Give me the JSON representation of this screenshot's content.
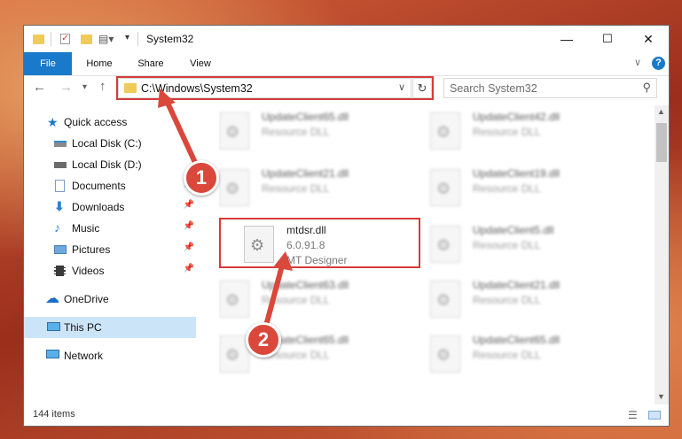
{
  "window": {
    "title": "System32",
    "controls": {
      "minimize": "—",
      "maximize": "☐",
      "close": "✕"
    }
  },
  "ribbon": {
    "tabs": [
      {
        "label": "File",
        "active": true
      },
      {
        "label": "Home"
      },
      {
        "label": "Share"
      },
      {
        "label": "View"
      }
    ],
    "help": "?"
  },
  "address": {
    "path": "C:\\Windows\\System32",
    "search_placeholder": "Search System32"
  },
  "nav": {
    "items": [
      {
        "label": "Quick access",
        "icon": "star-icon"
      },
      {
        "label": "Local Disk (C:)",
        "icon": "drive-icon"
      },
      {
        "label": "Local Disk (D:)",
        "icon": "drive-icon"
      },
      {
        "label": "Documents",
        "icon": "documents-icon",
        "pinned": true
      },
      {
        "label": "Downloads",
        "icon": "download-icon",
        "pinned": true
      },
      {
        "label": "Music",
        "icon": "music-icon",
        "pinned": true
      },
      {
        "label": "Pictures",
        "icon": "pictures-icon",
        "pinned": true
      },
      {
        "label": "Videos",
        "icon": "videos-icon",
        "pinned": true
      },
      {
        "label": "OneDrive",
        "icon": "cloud-icon"
      },
      {
        "label": "This PC",
        "icon": "pc-icon",
        "selected": true
      },
      {
        "label": "Network",
        "icon": "network-icon"
      }
    ]
  },
  "files": [
    {
      "name": "UpdateClient65.dll",
      "type": "Resource DLL"
    },
    {
      "name": "UpdateClient42.dll",
      "type": "Resource DLL"
    },
    {
      "name": "UpdateClient21.dll",
      "type": "Resource DLL"
    },
    {
      "name": "UpdateClient19.dll",
      "type": "Resource DLL"
    },
    {
      "name": "mtdsr.dll",
      "version": "6.0.91.8",
      "company": "MT Designer",
      "highlighted": true
    },
    {
      "name": "UpdateClient5.dll",
      "type": "Resource DLL"
    },
    {
      "name": "UpdateClient63.dll",
      "type": "Resource DLL"
    },
    {
      "name": "UpdateClient21.dll",
      "type": "Resource DLL"
    },
    {
      "name": "UpdateClient65.dll",
      "type": "Resource DLL"
    },
    {
      "name": "UpdateClient65.dll",
      "type": "Resource DLL"
    }
  ],
  "status": {
    "count": "144 items"
  },
  "callouts": [
    "1",
    "2"
  ],
  "colors": {
    "accent": "#1979ca",
    "highlight": "#d63a3a",
    "selected": "#cce4f7"
  }
}
